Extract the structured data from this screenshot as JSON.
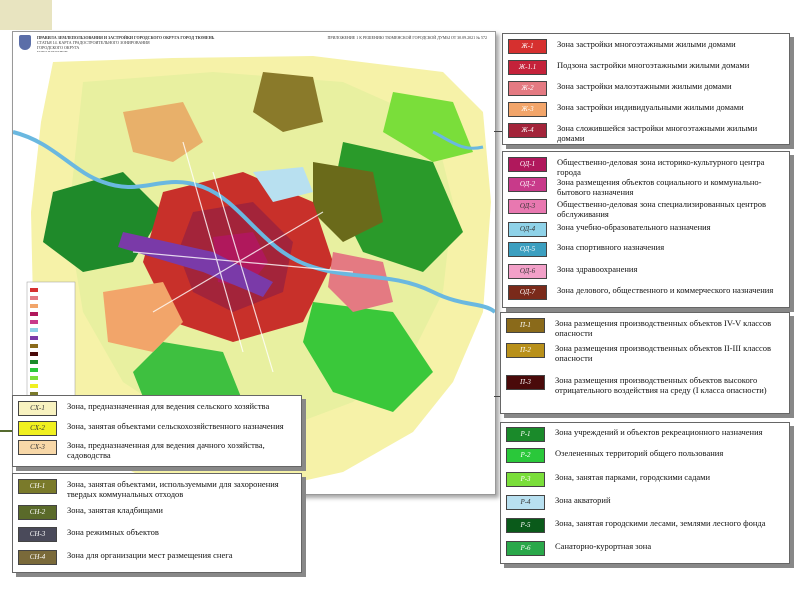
{
  "map": {
    "title": "ПРАВИЛА ЗЕМЛЕПОЛЬЗОВАНИЯ И ЗАСТРОЙКИ ГОРОДСКОГО ОКРУГА ГОРОД ТЮМЕНЬ",
    "line2": "СТАТЬЯ 14. КАРТА ГРАДОСТРОИТЕЛЬНОГО ЗОНИРОВАНИЯ",
    "line3": "ГОРОДСКОГО ОКРУГА",
    "line4": "ГОРОД ТЮМЕНЬ",
    "appendix": "ПРИЛОЖЕНИЕ 1 К РЕШЕНИЮ ТЮМЕНСКОЙ ГОРОДСКОЙ ДУМЫ ОТ 30.09.2021 № 572"
  },
  "legends": [
    {
      "id": "residential",
      "items": [
        {
          "code": "Ж-1",
          "color": "#d6302f",
          "text": "Зона застройки многоэтажными жилыми домами"
        },
        {
          "code": "Ж-1.1",
          "color": "#c4223a",
          "text": "Подзона застройки многоэтажными жилыми домами"
        },
        {
          "code": "Ж-2",
          "color": "#e47a82",
          "text": "Зона застройки малоэтажными жилыми домами"
        },
        {
          "code": "Ж-3",
          "color": "#f2a56a",
          "text": "Зона застройки индивидуальными жилыми домами"
        },
        {
          "code": "Ж-4",
          "color": "#a3243a",
          "text": "Зона сложившейся застройки многоэтажными жилыми домами"
        }
      ]
    },
    {
      "id": "public",
      "items": [
        {
          "code": "ОД-1",
          "color": "#b0185c",
          "text": "Общественно-деловая зона историко-культурного центра города"
        },
        {
          "code": "ОД-2",
          "color": "#c83a8a",
          "text": "Зона размещения объектов социального и коммунально-бытового назначения"
        },
        {
          "code": "ОД-3",
          "color": "#e878b0",
          "text": "Общественно-деловая зона специализированных центров обслуживания"
        },
        {
          "code": "ОД-4",
          "color": "#8fd2e8",
          "text": "Зона учебно-образовательного назначения"
        },
        {
          "code": "ОД-5",
          "color": "#3c9fc0",
          "text": "Зона спортивного назначения"
        },
        {
          "code": "ОД-6",
          "color": "#f2a0c8",
          "text": "Зона здравоохранения"
        },
        {
          "code": "ОД-7",
          "color": "#7a2a1a",
          "text": "Зона делового, общественного и коммерческого назначения"
        }
      ]
    },
    {
      "id": "industrial",
      "items": [
        {
          "code": "П-1",
          "color": "#8a6a1a",
          "text": "Зона размещения производственных объектов IV-V классов опасности"
        },
        {
          "code": "П-2",
          "color": "#b8901a",
          "text": "Зона размещения производственных объектов II-III классов опасности"
        },
        {
          "code": "П-3",
          "color": "#4a0a0a",
          "text": "Зона размещения производственных объектов высокого отрицательного воздействия на среду (I класса опасности)"
        }
      ]
    },
    {
      "id": "recreation",
      "items": [
        {
          "code": "Р-1",
          "color": "#1a8a2a",
          "text": "Зона учреждений и объектов рекреационного назначения"
        },
        {
          "code": "Р-2",
          "color": "#2ac83a",
          "text": "Озелененных территорий общего пользования"
        },
        {
          "code": "Р-3",
          "color": "#7ade3a",
          "text": "Зона, занятая парками, городскими садами"
        },
        {
          "code": "Р-4",
          "color": "#b8e0f0",
          "text": "Зона акваторий"
        },
        {
          "code": "Р-5",
          "color": "#0a5a1a",
          "text": "Зона, занятая городскими лесами, землями лесного фонда"
        },
        {
          "code": "Р-6",
          "color": "#2aa84a",
          "text": "Санаторно-курортная зона"
        }
      ]
    },
    {
      "id": "agricultural",
      "items": [
        {
          "code": "СХ-1",
          "color": "#f8f2c0",
          "text": "Зона, предназначенная для ведения сельского хозяйства"
        },
        {
          "code": "СХ-2",
          "color": "#f0f020",
          "text": "Зона, занятая объектами сельскохозяйственного назначения"
        },
        {
          "code": "СХ-3",
          "color": "#f8d8a8",
          "text": "Зона, предназначенная для ведения дачного хозяйства, садоводства"
        }
      ]
    },
    {
      "id": "special",
      "items": [
        {
          "code": "СН-1",
          "color": "#7a7a2a",
          "text": "Зона, занятая объектами, используемыми для захоронения твердых коммунальных отходов"
        },
        {
          "code": "СН-2",
          "color": "#5a6a2a",
          "text": "Зона, занятая кладбищами"
        },
        {
          "code": "СН-3",
          "color": "#4a4a5a",
          "text": "Зона режимных объектов"
        },
        {
          "code": "СН-4",
          "color": "#7a6a3a",
          "text": "Зона для организации мест размещения снега"
        }
      ]
    }
  ]
}
